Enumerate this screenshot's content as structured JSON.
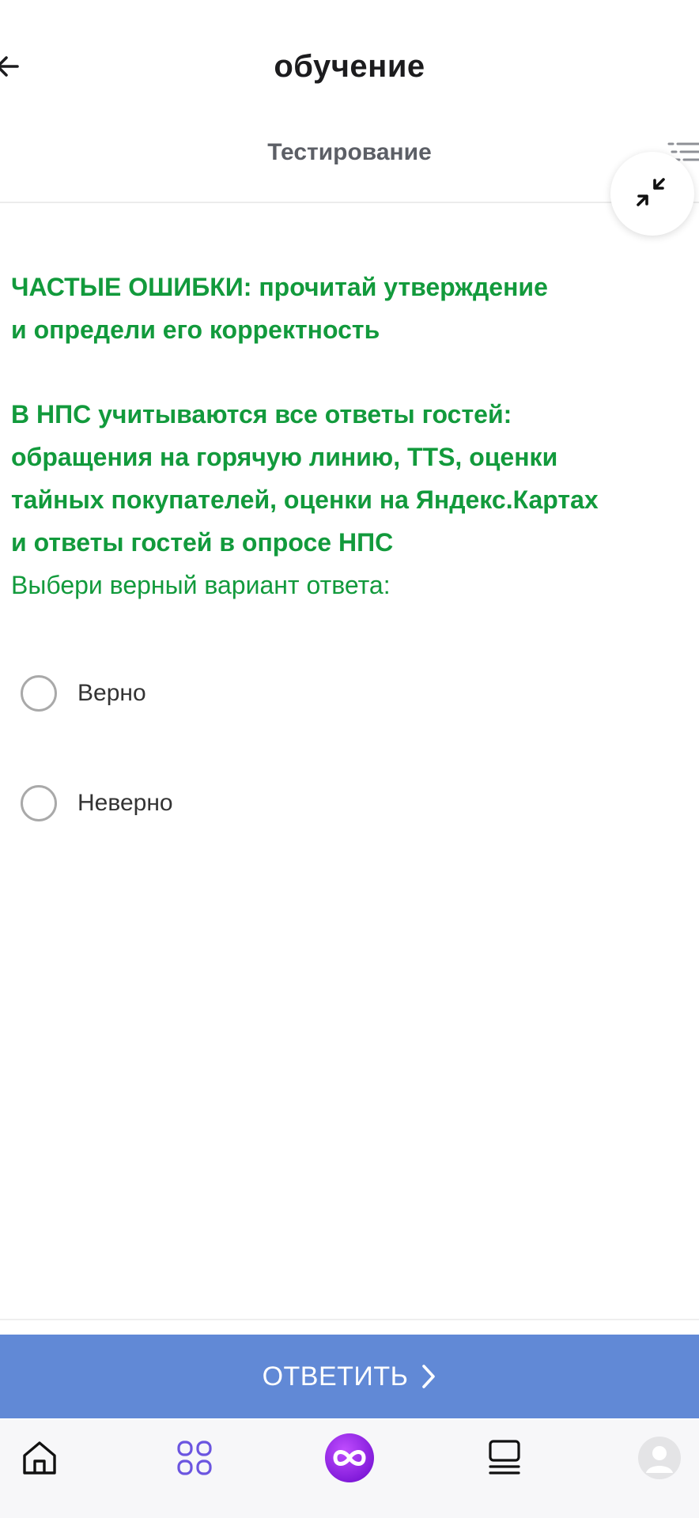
{
  "header": {
    "title": "обучение",
    "section_title": "Тестирование"
  },
  "question": {
    "lines": [
      "ЧАСТЫЕ ОШИБКИ: прочитай утверждение",
      "и определи его корректность",
      "В НПС учитываются все ответы гостей:",
      "обращения на горячую линию, TTS, оценки",
      "тайных покупателей, оценки на Яндекс.Картах",
      "и ответы гостей в опросе НПС"
    ],
    "prompt": "Выбери верный вариант ответа:",
    "text_color": "#129a3c"
  },
  "options": [
    {
      "label": "Верно",
      "selected": false
    },
    {
      "label": "Неверно",
      "selected": false
    }
  ],
  "submit": {
    "label": "ОТВЕТИТЬ",
    "color": "#6189d6"
  },
  "tabbar": {
    "items": [
      {
        "icon": "home-icon"
      },
      {
        "icon": "grid-icon",
        "color": "#6b55e0"
      },
      {
        "icon": "infinity-icon",
        "color": "#8a2be2"
      },
      {
        "icon": "stack-icon"
      },
      {
        "icon": "profile-icon"
      }
    ]
  }
}
